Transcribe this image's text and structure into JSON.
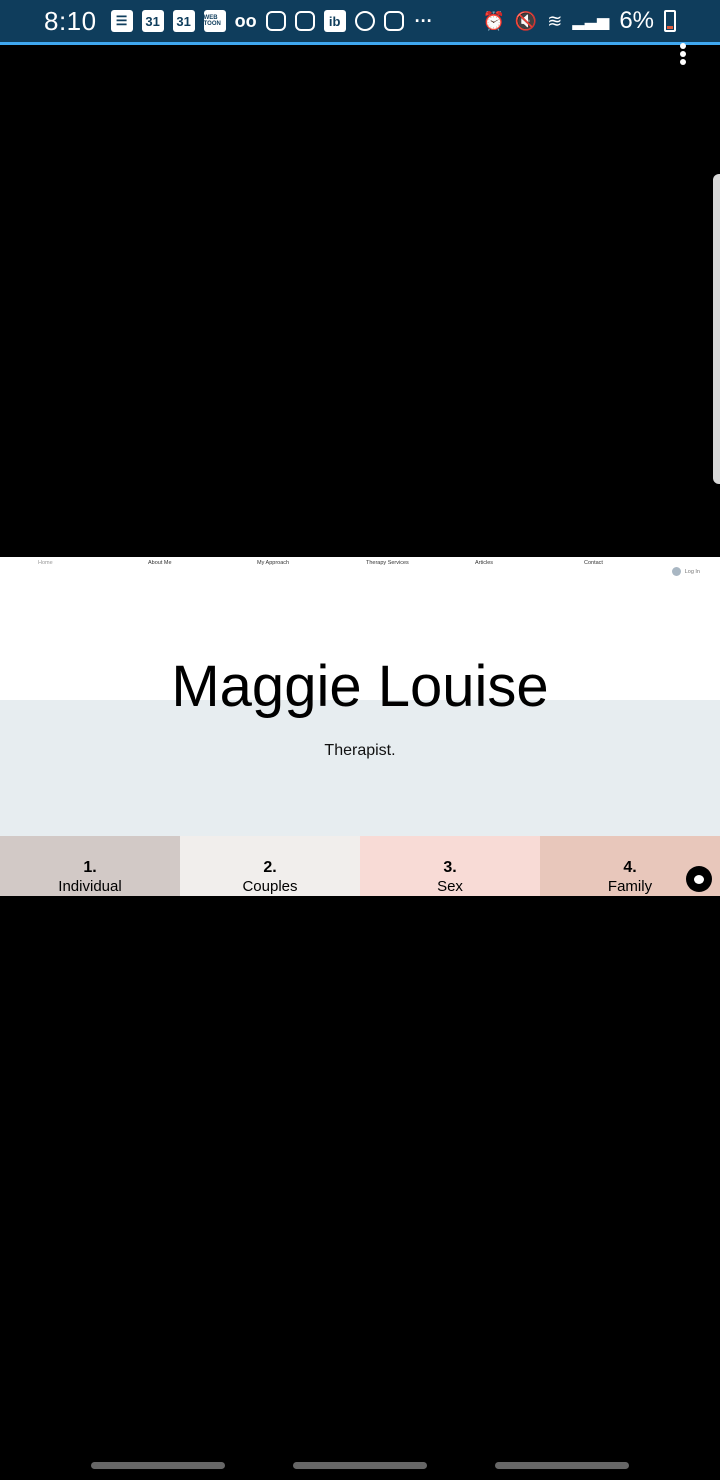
{
  "status_bar": {
    "time": "8:10",
    "notification_icons": [
      "message-icon",
      "calendar-icon",
      "calendar-icon",
      "webtoon-icon",
      "voicemail-icon",
      "instagram-icon",
      "instagram-icon",
      "ib-icon",
      "whatsapp-icon",
      "instagram-icon",
      "more-dots-icon"
    ],
    "calendar_day": "31",
    "webtoon_label": "WEB TOON",
    "ib_label": "ib",
    "more_label": "···",
    "battery_percent": "6%",
    "colors": {
      "background": "#0f3d5c",
      "accent_line": "#3fa8f0"
    }
  },
  "site": {
    "nav": [
      "Home",
      "About Me",
      "My Approach",
      "Therapy Services",
      "Articles",
      "Contact"
    ],
    "login_label": "Log In",
    "title": "Maggie Louise",
    "subtitle": "Therapist.",
    "cards": [
      {
        "num": "1.",
        "label": "Individual",
        "color": "#d2c9c6"
      },
      {
        "num": "2.",
        "label": "Couples",
        "color": "#f1eeec"
      },
      {
        "num": "3.",
        "label": "Sex",
        "color": "#f8dbd6"
      },
      {
        "num": "4.",
        "label": "Family",
        "color": "#e8c7bb"
      }
    ]
  }
}
